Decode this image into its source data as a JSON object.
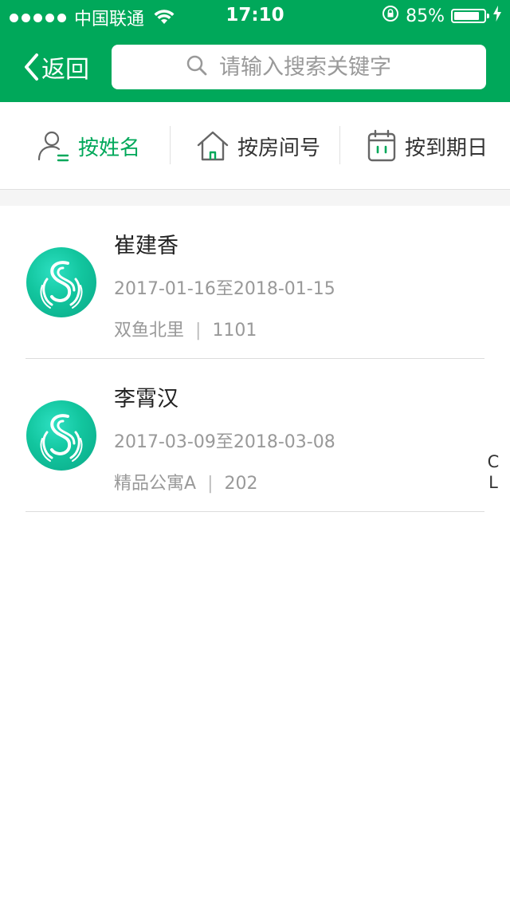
{
  "status_bar": {
    "carrier": "中国联通",
    "time": "17:10",
    "battery": "85%",
    "battery_level": 0.85
  },
  "nav": {
    "back_label": "返回",
    "search_placeholder": "请输入搜索关键字",
    "search_value": ""
  },
  "filters": [
    {
      "label": "按姓名",
      "icon": "person-icon",
      "active": true
    },
    {
      "label": "按房间号",
      "icon": "house-icon",
      "active": false
    },
    {
      "label": "按到期日",
      "icon": "calendar-icon",
      "active": false
    }
  ],
  "tenants": [
    {
      "name": "崔建香",
      "dates": "2017-01-16至2018-01-15",
      "building": "双鱼北里",
      "room": "1101"
    },
    {
      "name": "李霄汉",
      "dates": "2017-03-09至2018-03-08",
      "building": "精品公寓A",
      "room": "202"
    }
  ],
  "index_letters": [
    "C",
    "L"
  ],
  "colors": {
    "brand_green": "#00a85a",
    "avatar_teal": "#12c59e"
  }
}
